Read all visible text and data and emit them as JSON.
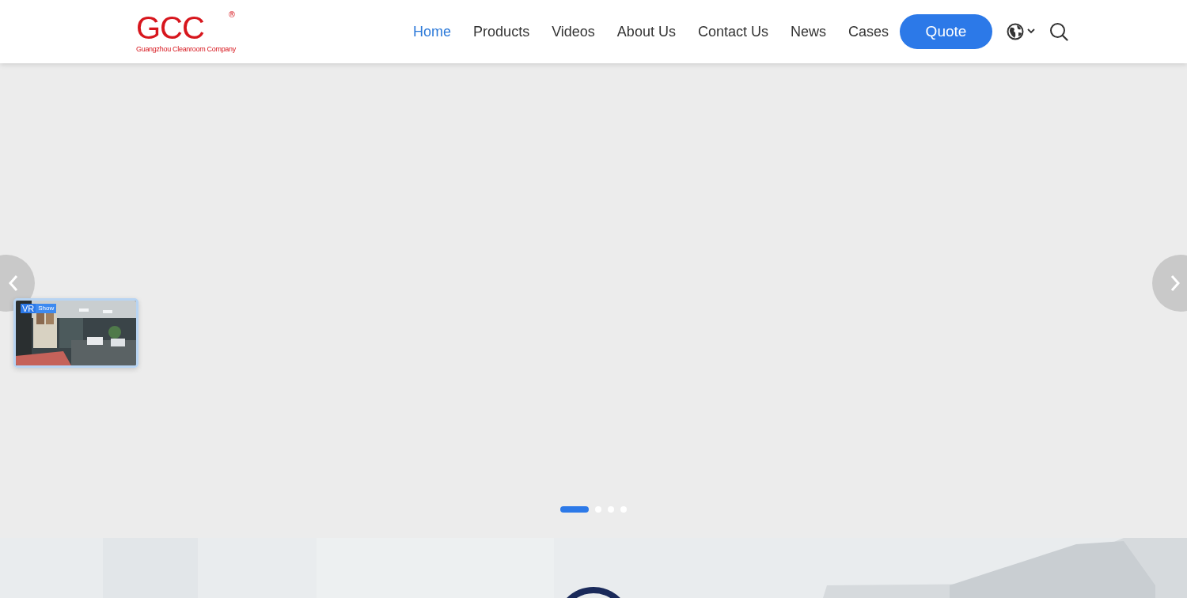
{
  "logo": {
    "mark": "GCC",
    "tagline": "Guangzhou Cleanroom Company",
    "registered": "®"
  },
  "nav": [
    {
      "label": "Home",
      "selected": true
    },
    {
      "label": "Products",
      "selected": false
    },
    {
      "label": "Videos",
      "selected": false
    },
    {
      "label": "About Us",
      "selected": false
    },
    {
      "label": "Contact Us",
      "selected": false
    },
    {
      "label": "News",
      "selected": false
    },
    {
      "label": "Cases",
      "selected": false
    }
  ],
  "quote_button": "Quote",
  "vr_thumbnail": {
    "badge_mark": "VR",
    "badge_text": "Show"
  },
  "slider_dots": [
    {
      "selected": true
    },
    {
      "selected": false
    },
    {
      "selected": false
    },
    {
      "selected": false
    }
  ]
}
